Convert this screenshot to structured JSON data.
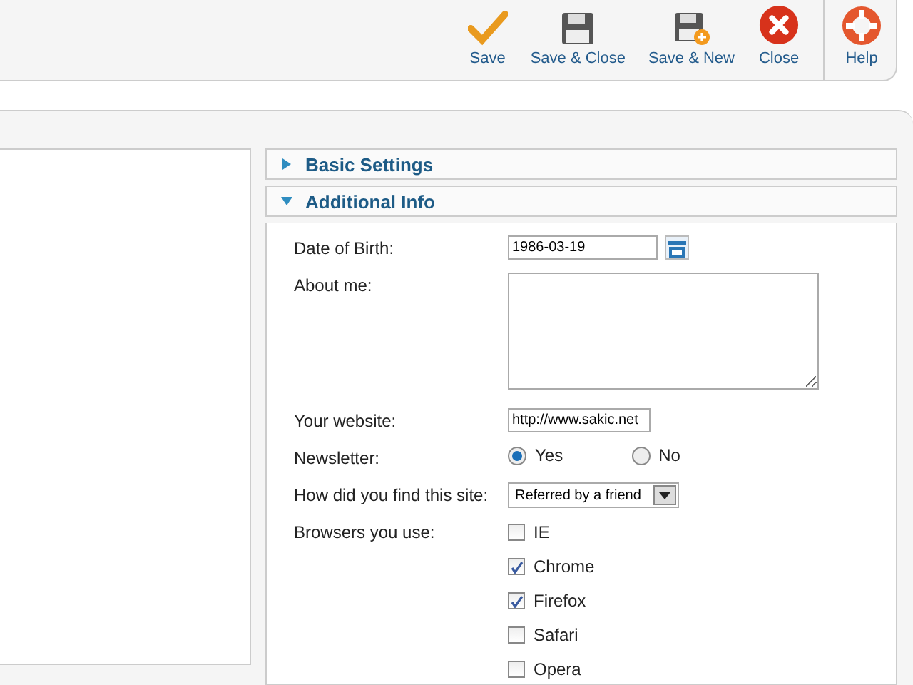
{
  "toolbar": [
    {
      "kind": "check",
      "label": "Save"
    },
    {
      "kind": "disk",
      "label": "Save & Close"
    },
    {
      "kind": "disk-plus",
      "label": "Save & New"
    },
    {
      "kind": "close",
      "label": "Close"
    },
    {
      "kind": "help",
      "label": "Help"
    }
  ],
  "sections": [
    {
      "title": "Basic Settings",
      "expanded": false
    },
    {
      "title": "Additional Info",
      "expanded": true
    }
  ],
  "fields": [
    {
      "kind": "date",
      "label": "Date of Birth:",
      "value": "1986-03-19"
    },
    {
      "kind": "textarea",
      "label": "About me:"
    },
    {
      "kind": "text",
      "label": "Your website:",
      "value": "http://www.sakic.net"
    },
    {
      "kind": "radio",
      "label": "Newsletter:",
      "options": [
        {
          "label": "Yes",
          "selected": true
        },
        {
          "label": "No",
          "selected": false
        }
      ]
    },
    {
      "kind": "select",
      "label": "How did you find this site:",
      "value": "Referred by a friend"
    },
    {
      "kind": "checkboxes",
      "label": "Browsers you use:",
      "options": [
        {
          "label": "IE",
          "checked": false
        },
        {
          "label": "Chrome",
          "checked": true
        },
        {
          "label": "Firefox",
          "checked": true
        },
        {
          "label": "Safari",
          "checked": false
        },
        {
          "label": "Opera",
          "checked": false
        }
      ]
    }
  ]
}
